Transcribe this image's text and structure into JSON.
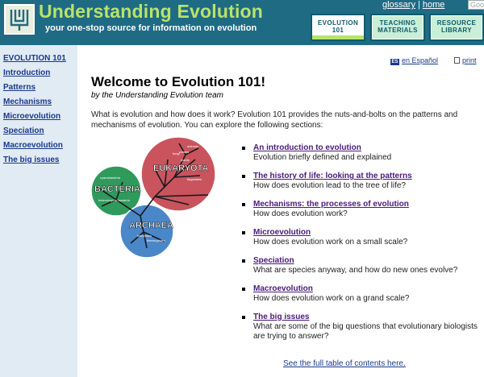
{
  "header": {
    "site_title": "Understanding Evolution",
    "tagline": "your one-stop source for information on evolution",
    "links": [
      {
        "label": "glossary"
      },
      {
        "label": "home"
      }
    ],
    "search_placeholder": "Goo",
    "tabs": [
      {
        "line1": "EVOLUTION",
        "line2": "101",
        "active": true
      },
      {
        "line1": "TEACHING",
        "line2": "MATERIALS",
        "active": false
      },
      {
        "line1": "RESOURCE",
        "line2": "LIBRARY",
        "active": false
      }
    ]
  },
  "sidebar": {
    "items": [
      {
        "label": "EVOLUTION 101"
      },
      {
        "label": "Introduction"
      },
      {
        "label": "Patterns"
      },
      {
        "label": "Mechanisms"
      },
      {
        "label": "Microevolution"
      },
      {
        "label": "Speciation"
      },
      {
        "label": "Macroevolution"
      },
      {
        "label": "The big issues"
      }
    ]
  },
  "utility": {
    "language_flag": "ES",
    "language_label": "en Español",
    "print_label": "print"
  },
  "main": {
    "title": "Welcome to Evolution 101!",
    "byline": "by the Understanding Evolution team",
    "intro": "What is evolution and how does it work? Evolution 101 provides the nuts-and-bolts on the patterns and mechanisms of evolution. You can explore the following sections:",
    "sections": [
      {
        "link": "An introduction to evolution",
        "desc": "Evolution briefly defined and explained"
      },
      {
        "link": "The history of life: looking at the patterns",
        "desc": "How does evolution lead to the tree of life?"
      },
      {
        "link": "Mechanisms: the processes of evolution",
        "desc": "How does evolution work?"
      },
      {
        "link": "Microevolution",
        "desc": "How does evolution work on a small scale?"
      },
      {
        "link": "Speciation",
        "desc": "What are species anyway, and how do new ones evolve?"
      },
      {
        "link": "Macroevolution",
        "desc": "How does evolution work on a grand scale?"
      },
      {
        "link": "The big issues",
        "desc": "What are some of the big questions that evolutionary biologists are trying to answer?"
      }
    ],
    "toc_link": "See the full table of contents here."
  },
  "diagram": {
    "domains": [
      {
        "label": "EUKARYOTA",
        "color": "#c9545e"
      },
      {
        "label": "BACTERIA",
        "color": "#2f9a5c"
      },
      {
        "label": "ARCHAEA",
        "color": "#4a87c8"
      }
    ],
    "groups": [
      "animals",
      "fungi",
      "plants",
      "ciliates",
      "flagellates",
      "cyanobacteria",
      "heterotrophic bacteria",
      "halophiles",
      "thermophiles"
    ]
  },
  "colors": {
    "header_bg": "#1f6b84",
    "title_green": "#b9e36a",
    "sidebar_bg": "#e1ebf4",
    "link_blue": "#1a3a8a",
    "link_purple": "#4a1a7a"
  }
}
